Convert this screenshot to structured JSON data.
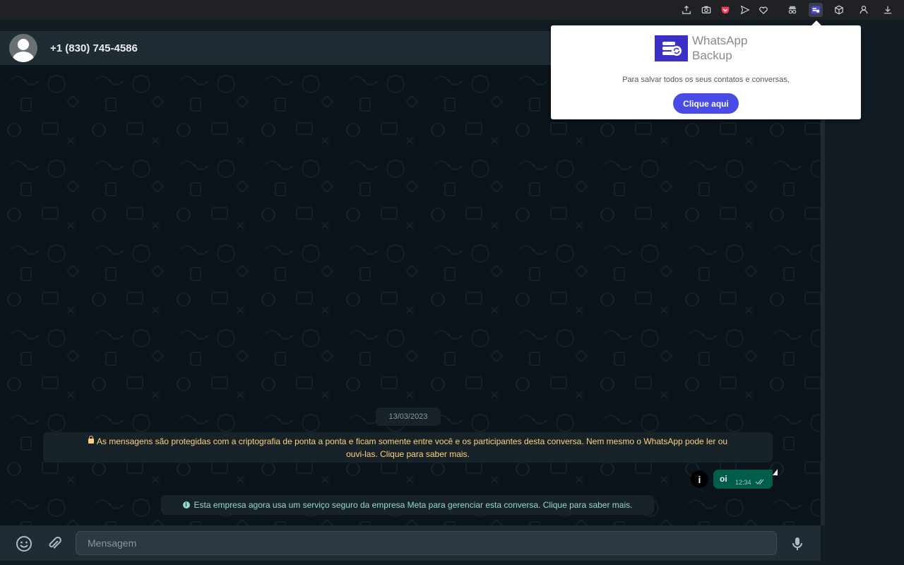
{
  "browser": {
    "extensions": [
      "share-icon",
      "camera-icon",
      "pocket-icon",
      "send-icon",
      "heart-icon",
      "incognito-icon",
      "whatsapp-backup-extension-icon",
      "box-icon",
      "profile-icon",
      "download-icon"
    ]
  },
  "chat": {
    "contact_name": "+1 (830) 745-4586",
    "date_chip": "13/03/2023",
    "e2e_notice_line1": "As mensagens são protegidas com a criptografia de ponta a ponta e ficam somente entre você e os participantes desta conversa. Nem mesmo o WhatsApp pode ler ou",
    "e2e_notice_line2": "ouvi-las. Clique para saber mais.",
    "message": {
      "text": "oi",
      "time": "12:34",
      "info_label": "i"
    },
    "meta_notice": "Esta empresa agora usa um serviço seguro da empresa Meta para gerenciar esta conversa. Clique para saber mais.",
    "info_dot": "i"
  },
  "composer": {
    "placeholder": "Mensagem"
  },
  "popup": {
    "title_line1": "WhatsApp",
    "title_line2": "Backup",
    "text": "Para salvar todos os seus contatos e conversas,",
    "button_label": "Clique aqui"
  },
  "colors": {
    "accent_button": "#4a4be6",
    "bubble": "#005c4b",
    "notice_yellow": "#ffd279",
    "notice_teal": "#8ddcc7"
  }
}
